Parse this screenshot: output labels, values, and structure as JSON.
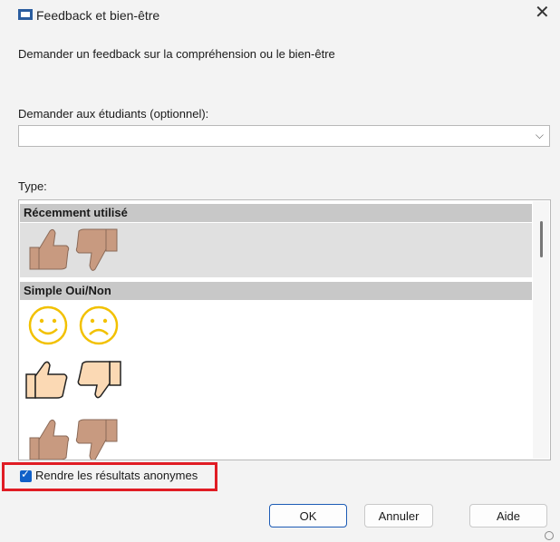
{
  "window": {
    "title": "Feedback et bien-être",
    "close_glyph": "✕"
  },
  "subtitle": "Demander un feedback sur la compréhension ou le bien-être",
  "ask": {
    "label": "Demander aux étudiants (optionnel):",
    "value": "",
    "arrow_glyph": "⌵"
  },
  "type": {
    "label": "Type:",
    "groups": [
      {
        "name": "Récemment utilisé",
        "icons": [
          "thumbs-up-brown-icon",
          "thumbs-down-brown-icon"
        ]
      },
      {
        "name": "Simple Oui/Non",
        "icons": [
          "smiley-happy-icon",
          "smiley-sad-icon",
          "thumbs-up-outline-icon",
          "thumbs-down-outline-icon",
          "thumbs-up-brown-icon",
          "thumbs-down-brown-icon"
        ]
      }
    ]
  },
  "anonymous": {
    "label": "Rendre les résultats anonymes",
    "checked": true
  },
  "buttons": {
    "ok": "OK",
    "cancel": "Annuler",
    "help": "Aide"
  },
  "colors": {
    "accent": "#1060c8",
    "highlight_box": "#e01c24",
    "skin": "#c89a80",
    "smiley": "#f2c100"
  }
}
